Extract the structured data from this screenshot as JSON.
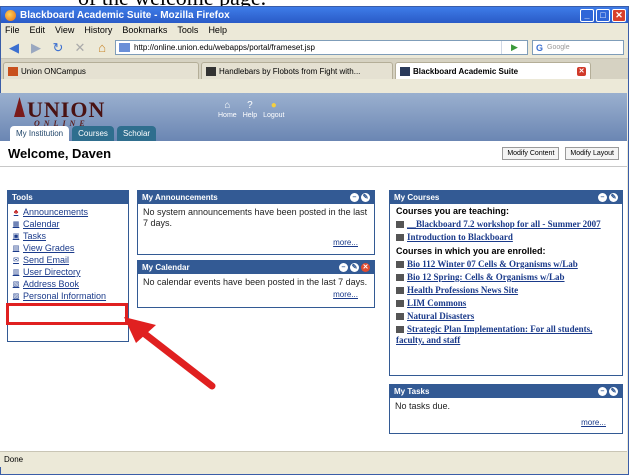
{
  "doc": {
    "caption": "of the welcome page."
  },
  "browser": {
    "title": "Blackboard Academic Suite - Mozilla Firefox",
    "menu": [
      "File",
      "Edit",
      "View",
      "History",
      "Bookmarks",
      "Tools",
      "Help"
    ],
    "url": "http://online.union.edu/webapps/portal/frameset.jsp",
    "search_placeholder": "Google",
    "tabs": [
      {
        "label": "Union ONCampus",
        "active": false
      },
      {
        "label": "Handlebars by Flobots from Fight with...",
        "active": false
      },
      {
        "label": "Blackboard Academic Suite",
        "active": true
      }
    ],
    "status": "Done"
  },
  "bb": {
    "logo_main": "UNION",
    "logo_sub": "ONLINE",
    "header_tools": [
      "Home",
      "Help",
      "Logout"
    ],
    "tabs": [
      "My Institution",
      "Courses",
      "Scholar"
    ],
    "welcome": "Welcome, Daven",
    "modify_content": "Modify Content",
    "modify_layout": "Modify Layout",
    "tools": {
      "title": "Tools",
      "items": [
        "Announcements",
        "Calendar",
        "Tasks",
        "View Grades",
        "Send Email",
        "User Directory",
        "Address Book",
        "Personal Information"
      ]
    },
    "announcements": {
      "title": "My Announcements",
      "body": "No system announcements have been posted in the last 7 days.",
      "more": "more..."
    },
    "calendar": {
      "title": "My Calendar",
      "body": "No calendar events have been posted in the last 7 days.",
      "more": "more..."
    },
    "courses": {
      "title": "My Courses",
      "teaching_heading": "Courses you are teaching:",
      "teaching": [
        "__Blackboard 7.2 workshop for all - Summer 2007",
        "Introduction to Blackboard"
      ],
      "enrolled_heading": "Courses in which you are enrolled:",
      "enrolled": [
        "Bio 112 Winter 07 Cells & Organisms w/Lab",
        "Bio 12 Spring: Cells & Organisms w/Lab",
        "Health Professions News Site",
        "LIM Commons",
        "Natural Disasters",
        "Strategic Plan Implementation: For all students, faculty, and staff"
      ]
    },
    "tasks": {
      "title": "My Tasks",
      "body": "No tasks due.",
      "more": "more..."
    }
  },
  "colors": {
    "module_header": "#335a94",
    "highlight": "#e02020",
    "link": "#1a3a8a"
  }
}
